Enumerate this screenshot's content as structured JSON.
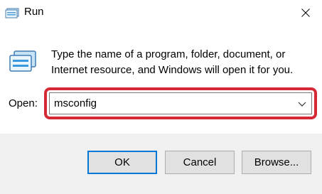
{
  "window": {
    "title": "Run",
    "title_icon": "run-app-icon",
    "close_icon": "close-icon"
  },
  "body": {
    "app_icon": "run-app-icon",
    "description": "Type the name of a program, folder, document, or Internet resource, and Windows will open it for you."
  },
  "open_field": {
    "label": "Open:",
    "value": "msconfig",
    "dropdown_icon": "chevron-down-icon"
  },
  "buttons": {
    "ok": "OK",
    "cancel": "Cancel",
    "browse": "Browse..."
  },
  "colors": {
    "highlight": "#d42a36",
    "default_button_border": "#0078d7",
    "footer_bg": "#f0f0f0"
  }
}
